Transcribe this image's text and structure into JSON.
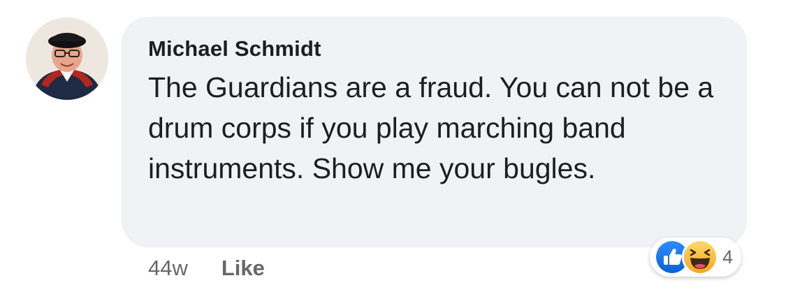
{
  "comment": {
    "author": "Michael Schmidt",
    "text": "The Guardians are a fraud. You can not be a drum corps if you play marching band instruments. Show me your bugles.",
    "timestamp": "44w",
    "like_label": "Like"
  },
  "reactions": {
    "icons": [
      "like-reaction-icon",
      "haha-reaction-icon"
    ],
    "count": "4"
  },
  "colors": {
    "bubble": "#f0f2f5",
    "text": "#1c1e21",
    "secondary_text": "#65676b",
    "like_blue": "#1877f2",
    "haha_yellow": "#f7b125"
  }
}
